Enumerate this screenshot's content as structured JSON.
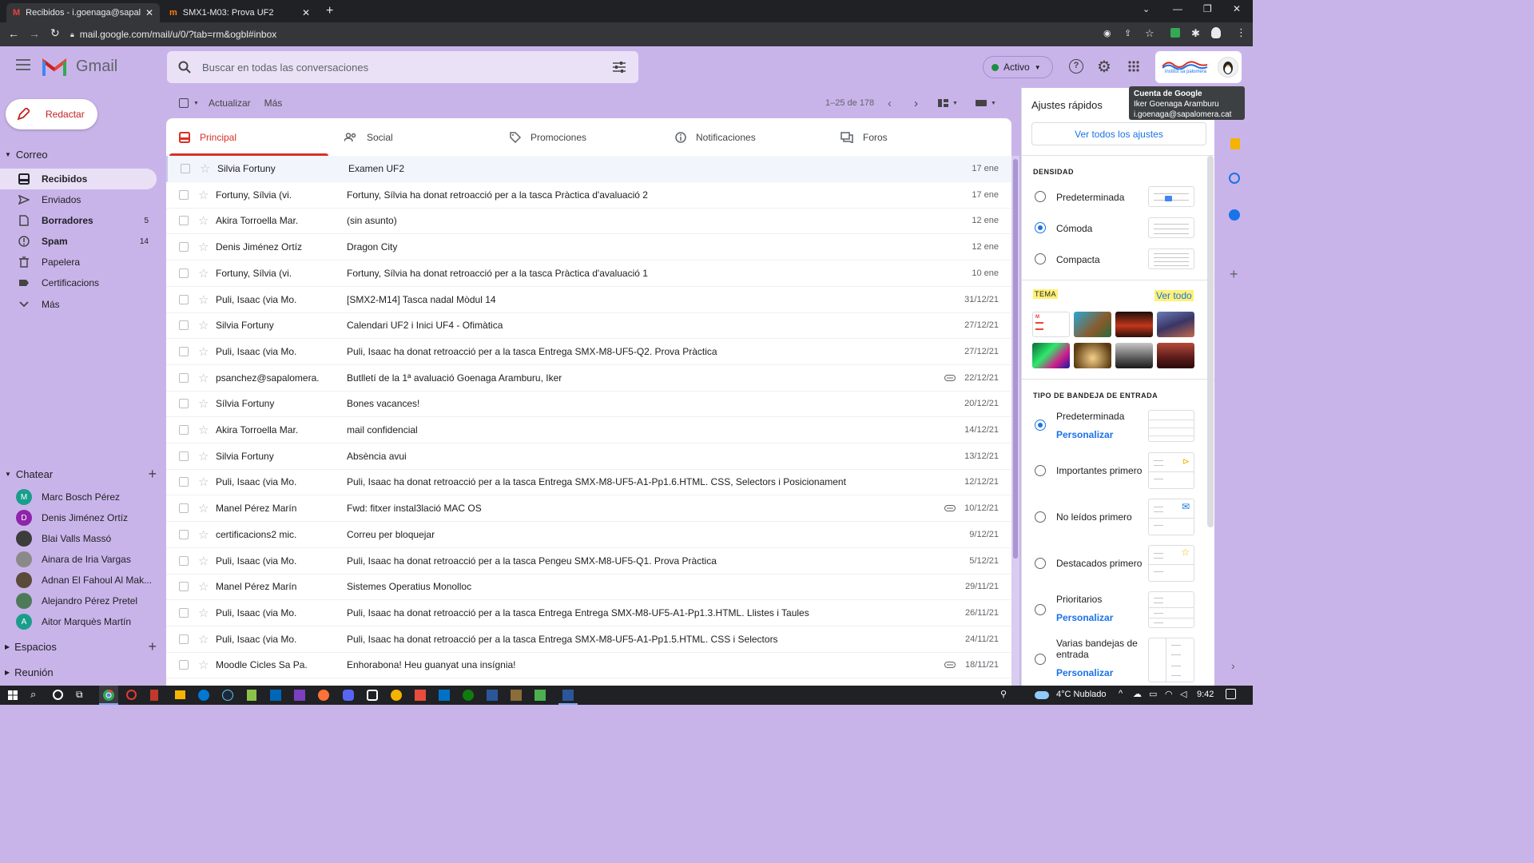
{
  "browser": {
    "tabs": [
      {
        "title": "Recibidos - i.goenaga@sapalomera.cat",
        "icon": "gmail-icon"
      },
      {
        "title": "SMX1-M03: Prova UF2",
        "icon": "moodle-icon"
      }
    ],
    "url": "mail.google.com/mail/u/0/?tab=rm&ogbl#inbox"
  },
  "gmail": {
    "logo_text": "Gmail",
    "search_placeholder": "Buscar en todas las conversaciones",
    "status": "Activo",
    "account_logo": "institut sa palomera"
  },
  "tooltip": {
    "title": "Cuenta de Google",
    "name": "Iker Goenaga Aramburu",
    "email": "i.goenaga@sapalomera.cat"
  },
  "sidebar": {
    "compose": "Redactar",
    "mail_header": "Correo",
    "items": [
      {
        "label": "Recibidos",
        "count": "",
        "icon": "inbox-icon"
      },
      {
        "label": "Enviados",
        "count": "",
        "icon": "send-icon"
      },
      {
        "label": "Borradores",
        "count": "5",
        "icon": "draft-icon"
      },
      {
        "label": "Spam",
        "count": "14",
        "icon": "spam-icon"
      },
      {
        "label": "Papelera",
        "count": "",
        "icon": "trash-icon"
      },
      {
        "label": "Certificacions",
        "count": "",
        "icon": "label-icon"
      },
      {
        "label": "Más",
        "count": "",
        "icon": "chevron-down-icon"
      }
    ],
    "chat_header": "Chatear",
    "contacts": [
      {
        "name": "Marc Bosch Pérez",
        "initial": "M",
        "color": "#1a9e8c"
      },
      {
        "name": "Denis Jiménez Ortíz",
        "initial": "D",
        "color": "#8e24aa"
      },
      {
        "name": "Blai Valls Massó",
        "initial": "",
        "color": "#3c3c3c"
      },
      {
        "name": "Ainara de Iria Vargas",
        "initial": "",
        "color": "#8a8a8a"
      },
      {
        "name": "Adnan El Fahoul Al Mak...",
        "initial": "",
        "color": "#5a4a3a"
      },
      {
        "name": "Alejandro Pérez Pretel",
        "initial": "",
        "color": "#4e7a5a"
      },
      {
        "name": "Aitor Marquès Martín",
        "initial": "A",
        "color": "#1a9e8c"
      }
    ],
    "spaces": "Espacios",
    "meeting": "Reunión"
  },
  "toolbar": {
    "refresh": "Actualizar",
    "more": "Más",
    "pagination": "1–25 de 178"
  },
  "categories": [
    {
      "label": "Principal",
      "icon": "inbox-icon"
    },
    {
      "label": "Social",
      "icon": "people-icon"
    },
    {
      "label": "Promociones",
      "icon": "tag-icon"
    },
    {
      "label": "Notificaciones",
      "icon": "info-icon"
    },
    {
      "label": "Foros",
      "icon": "forum-icon"
    }
  ],
  "emails": [
    {
      "sender": "Silvia Fortuny",
      "subject": "Examen UF2",
      "date": "17 ene",
      "attachment": false
    },
    {
      "sender": "Fortuny, Sílvia (vi.",
      "subject": "Fortuny, Sílvia ha donat retroacció per a la tasca Pràctica d'avaluació 2",
      "date": "17 ene",
      "attachment": false
    },
    {
      "sender": "Akira Torroella Mar.",
      "subject": "(sin asunto)",
      "date": "12 ene",
      "attachment": false
    },
    {
      "sender": "Denis Jiménez Ortíz",
      "subject": "Dragon City",
      "date": "12 ene",
      "attachment": false
    },
    {
      "sender": "Fortuny, Sílvia (vi.",
      "subject": "Fortuny, Sílvia ha donat retroacció per a la tasca Pràctica d'avaluació 1",
      "date": "10 ene",
      "attachment": false
    },
    {
      "sender": "Puli, Isaac (via Mo.",
      "subject": "[SMX2-M14] Tasca nadal Mòdul 14",
      "date": "31/12/21",
      "attachment": false
    },
    {
      "sender": "Silvia Fortuny",
      "subject": "Calendari UF2 i Inici UF4 - Ofimàtica",
      "date": "27/12/21",
      "attachment": false
    },
    {
      "sender": "Puli, Isaac (via Mo.",
      "subject": "Puli, Isaac ha donat retroacció per a la tasca Entrega SMX-M8-UF5-Q2. Prova Pràctica",
      "date": "27/12/21",
      "attachment": false
    },
    {
      "sender": "psanchez@sapalomera.",
      "subject": "Butlletí de la 1ª avaluació Goenaga Aramburu, Iker",
      "date": "22/12/21",
      "attachment": true
    },
    {
      "sender": "Sílvia Fortuny",
      "subject": "Bones vacances!",
      "date": "20/12/21",
      "attachment": false
    },
    {
      "sender": "Akira Torroella Mar.",
      "subject": "mail confidencial",
      "date": "14/12/21",
      "attachment": false
    },
    {
      "sender": "Silvia Fortuny",
      "subject": "Absència avui",
      "date": "13/12/21",
      "attachment": false
    },
    {
      "sender": "Puli, Isaac (via Mo.",
      "subject": "Puli, Isaac ha donat retroacció per a la tasca Entrega SMX-M8-UF5-A1-Pp1.6.HTML. CSS, Selectors i Posicionament",
      "date": "12/12/21",
      "attachment": false
    },
    {
      "sender": "Manel Pérez Marín",
      "subject": "Fwd: fitxer instal3lació MAC OS",
      "date": "10/12/21",
      "attachment": true
    },
    {
      "sender": "certificacions2 mic.",
      "subject": "Correu per bloquejar",
      "date": "9/12/21",
      "attachment": false
    },
    {
      "sender": "Puli, Isaac (via Mo.",
      "subject": "Puli, Isaac ha donat retroacció per a la tasca Pengeu SMX-M8-UF5-Q1. Prova Pràctica",
      "date": "5/12/21",
      "attachment": false
    },
    {
      "sender": "Manel Pérez Marín",
      "subject": "Sistemes Operatius Monolloc",
      "date": "29/11/21",
      "attachment": false
    },
    {
      "sender": "Puli, Isaac (via Mo.",
      "subject": "Puli, Isaac ha donat retroacció per a la tasca Entrega Entrega SMX-M8-UF5-A1-Pp1.3.HTML. Llistes i Taules",
      "date": "26/11/21",
      "attachment": false
    },
    {
      "sender": "Puli, Isaac (via Mo.",
      "subject": "Puli, Isaac ha donat retroacció per a la tasca Entrega SMX-M8-UF5-A1-Pp1.5.HTML. CSS i Selectors",
      "date": "24/11/21",
      "attachment": false
    },
    {
      "sender": "Moodle Cicles Sa Pa.",
      "subject": "Enhorabona! Heu guanyat una insígnia!",
      "date": "18/11/21",
      "attachment": true
    }
  ],
  "quick_settings": {
    "title": "Ajustes rápidos",
    "all_settings": "Ver todos los ajustes",
    "density_header": "DENSIDAD",
    "density": [
      {
        "label": "Predeterminada",
        "selected": false
      },
      {
        "label": "Cómoda",
        "selected": true
      },
      {
        "label": "Compacta",
        "selected": false
      }
    ],
    "theme_header": "TEMA",
    "theme_view_all": "Ver todo",
    "inbox_type_header": "TIPO DE BANDEJA DE ENTRADA",
    "inbox_types": [
      {
        "label": "Predeterminada",
        "link": "Personalizar",
        "selected": true
      },
      {
        "label": "Importantes primero",
        "link": "",
        "selected": false
      },
      {
        "label": "No leídos primero",
        "link": "",
        "selected": false
      },
      {
        "label": "Destacados primero",
        "link": "",
        "selected": false
      },
      {
        "label": "Prioritarios",
        "link": "Personalizar",
        "selected": false
      },
      {
        "label": "Varias bandejas de entrada",
        "link": "Personalizar",
        "selected": false
      }
    ]
  },
  "taskbar": {
    "weather": "4°C  Nublado",
    "time": "9:42"
  },
  "colors": {
    "background": "#c9b4ea",
    "accent": "#1a73e8",
    "principal_red": "#d93025"
  }
}
